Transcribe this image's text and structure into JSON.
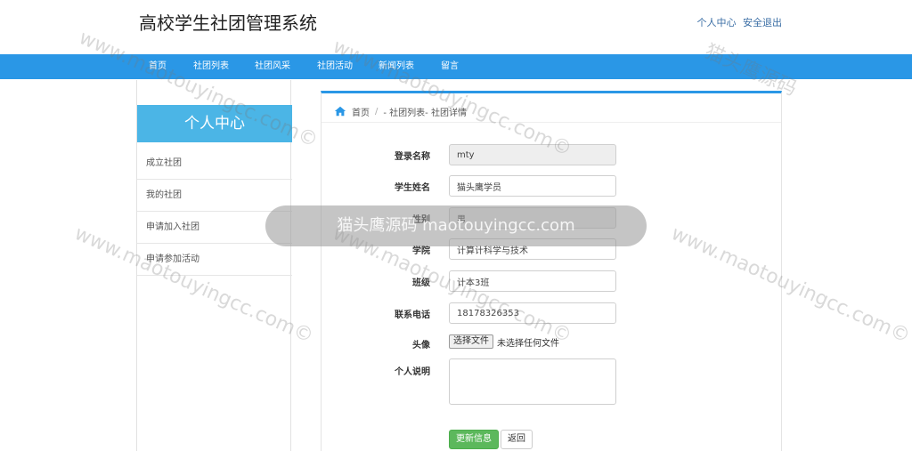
{
  "header": {
    "title": "高校学生社团管理系统",
    "links": [
      "个人中心",
      "安全退出"
    ]
  },
  "nav": {
    "items": [
      "首页",
      "社团列表",
      "社团风采",
      "社团活动",
      "新闻列表",
      "留言"
    ]
  },
  "sidebar": {
    "title": "个人中心",
    "items": [
      "成立社团",
      "我的社团",
      "申请加入社团",
      "申请参加活动"
    ]
  },
  "breadcrumb": {
    "home": "首页",
    "separator": "/",
    "path": "- 社团列表- 社团详情"
  },
  "form": {
    "login_label": "登录名称",
    "login_value": "mty",
    "name_label": "学生姓名",
    "name_value": "猫头鹰学员",
    "gender_label": "性别",
    "gender_value": "男",
    "college_label": "学院",
    "college_value": "计算计科学与技术",
    "class_label": "班级",
    "class_value": "计本3班",
    "phone_label": "联系电话",
    "phone_value": "18178326353",
    "avatar_label": "头像",
    "file_button": "选择文件",
    "file_status": "未选择任何文件",
    "bio_label": "个人说明",
    "bio_value": ""
  },
  "buttons": {
    "update": "更新信息",
    "back": "返回"
  },
  "watermark": {
    "text": "猫头鹰源码",
    "site": "www.maotouyingcc.com©",
    "banner": "猫头鹰源码 maotouyingcc.com"
  },
  "colors": {
    "nav_bg": "#2a97e6",
    "sidebar_header_bg": "#4bb5e6",
    "update_button": "#5cb85c"
  }
}
